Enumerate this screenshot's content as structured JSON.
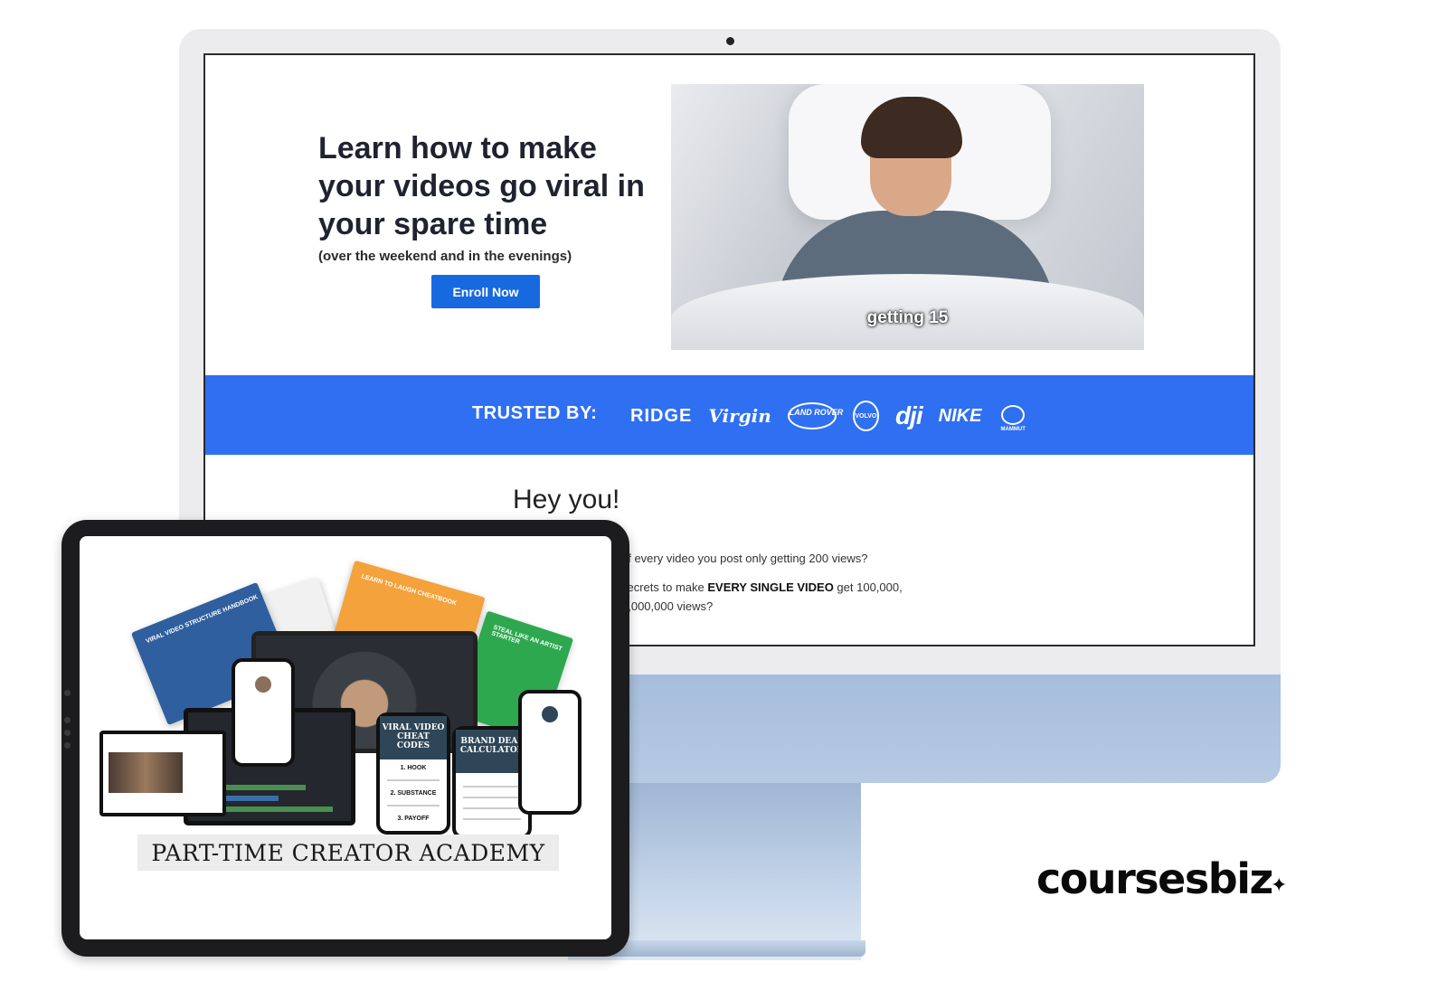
{
  "hero": {
    "title": "Learn how to make your videos go viral in your spare time",
    "subtitle": "(over the weekend and in the evenings)",
    "enroll_label": "Enroll Now"
  },
  "video": {
    "caption": "getting 15"
  },
  "trust": {
    "label": "TRUSTED BY:",
    "brands": [
      "RIDGE",
      "Virgin",
      "LAND ROVER",
      "VOLVO",
      "dji",
      "NIKE",
      "MAMMUT"
    ]
  },
  "content": {
    "heading": "Hey you!",
    "line1": "of every video you post only getting 200 views?",
    "line2_pre": "secrets to make ",
    "line2_bold": "EVERY SINGLE VIDEO",
    "line2_post": " get 100,000,",
    "line3": "1,000,000 views?"
  },
  "product": {
    "title": "PART-TIME CREATOR ACADEMY",
    "book_blue": "VIRAL VIDEO STRUCTURE HANDBOOK",
    "book_orange": "LEARN TO LAUGH CHEATBOOK",
    "book_green": "STEAL LIKE AN ARTIST STARTER",
    "cheat_title": "VIRAL VIDEO CHEAT CODES",
    "cheat_items": [
      "1. HOOK",
      "2. SUBSTANCE",
      "3. PAYOFF"
    ],
    "brand_title": "BRAND DEAL CALCULATOR"
  },
  "footer": {
    "wordmark": "coursesbiz",
    "spark": "✦"
  },
  "colors": {
    "accent_blue": "#2f6ff2",
    "button_blue": "#1769e0",
    "monitor_chin": "#a6bedc"
  }
}
